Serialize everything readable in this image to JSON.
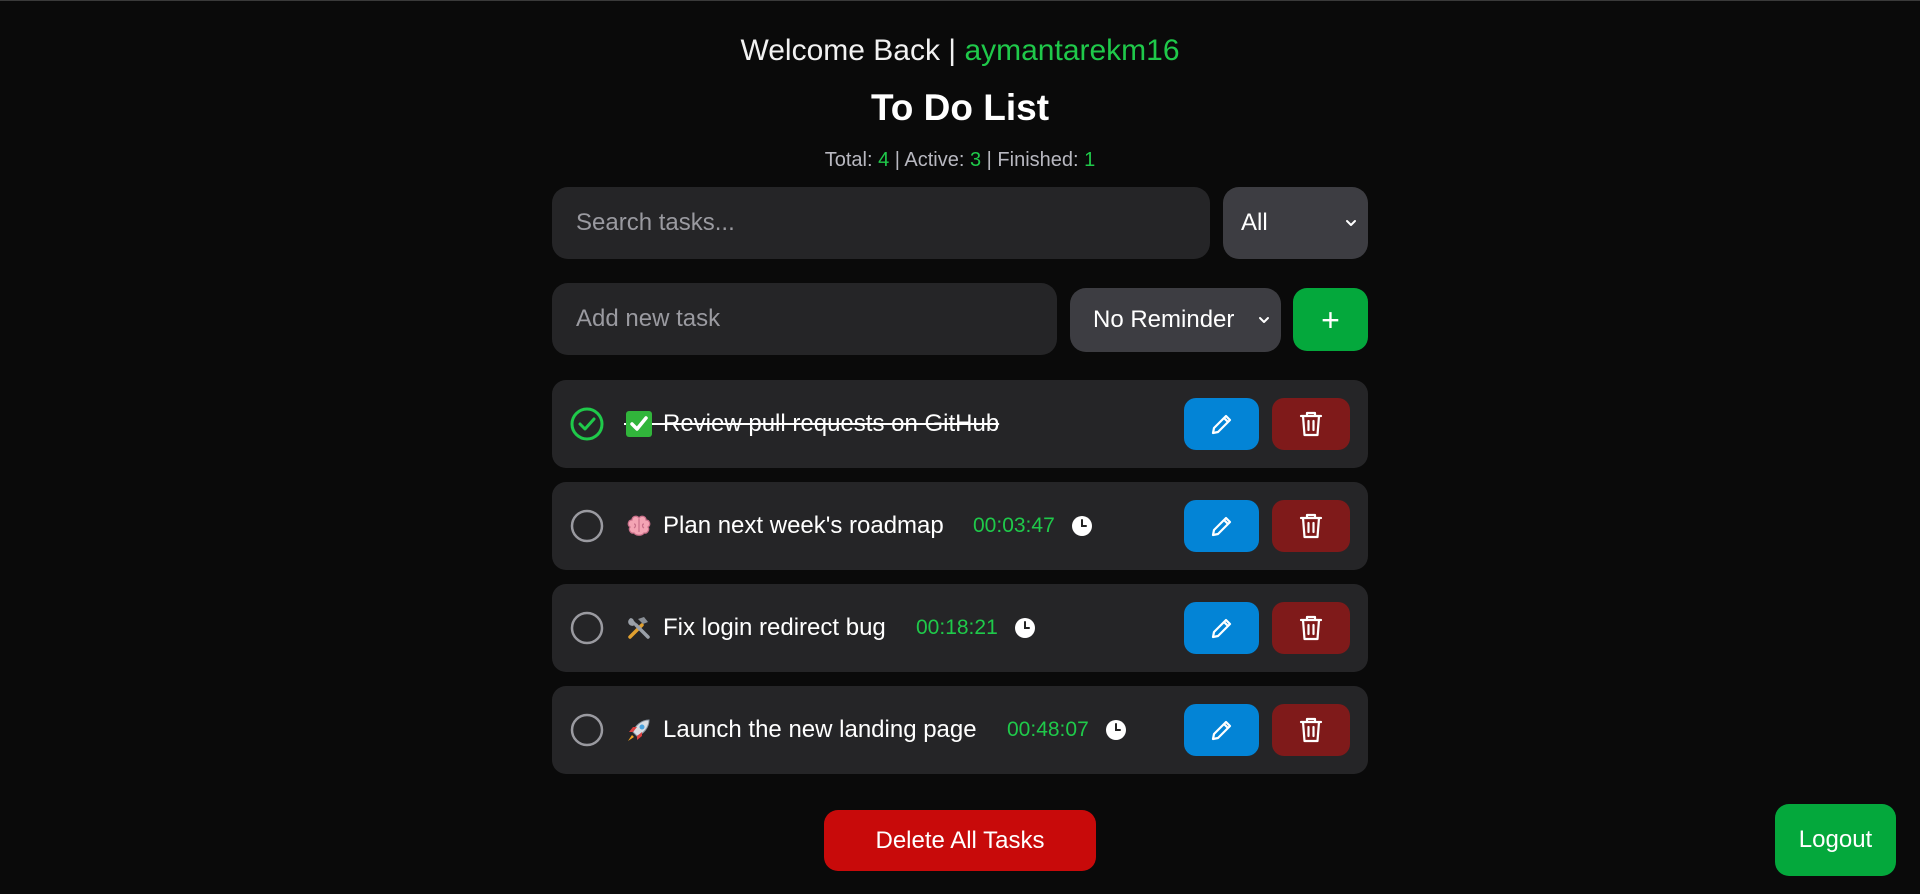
{
  "header": {
    "welcome": "Welcome Back | ",
    "username": "aymantarekm16"
  },
  "title": "To Do List",
  "stats": {
    "total_label": "Total: ",
    "total": "4",
    "active_label": " | Active: ",
    "active": "3",
    "finished_label": " | Finished: ",
    "finished": "1"
  },
  "search": {
    "placeholder": "Search tasks...",
    "value": ""
  },
  "filter": {
    "selected": "All"
  },
  "new_task": {
    "placeholder": "Add new task",
    "value": ""
  },
  "reminder": {
    "selected": "No Reminder"
  },
  "add_button": {
    "label": "+"
  },
  "tasks": [
    {
      "emoji": "white-check-mark-emoji",
      "text": "Review pull requests on GitHub",
      "done": true,
      "timer": ""
    },
    {
      "emoji": "brain-emoji",
      "text": "Plan next week's roadmap",
      "done": false,
      "timer": "00:03:47"
    },
    {
      "emoji": "hammer-and-wrench-emoji",
      "text": "Fix login redirect bug",
      "done": false,
      "timer": "00:18:21"
    },
    {
      "emoji": "rocket-emoji",
      "text": "Launch the new landing page",
      "done": false,
      "timer": "00:48:07"
    }
  ],
  "delete_all": {
    "label": "Delete All Tasks"
  },
  "logout": {
    "label": "Logout"
  },
  "colors": {
    "background": "#0a0a0a",
    "accent_green": "#1fc94a",
    "button_green": "#04a83c",
    "edit_blue": "#0384d6",
    "delete_red": "#7f1a1a",
    "delete_all_red": "#c80a0a",
    "card": "#252527"
  }
}
